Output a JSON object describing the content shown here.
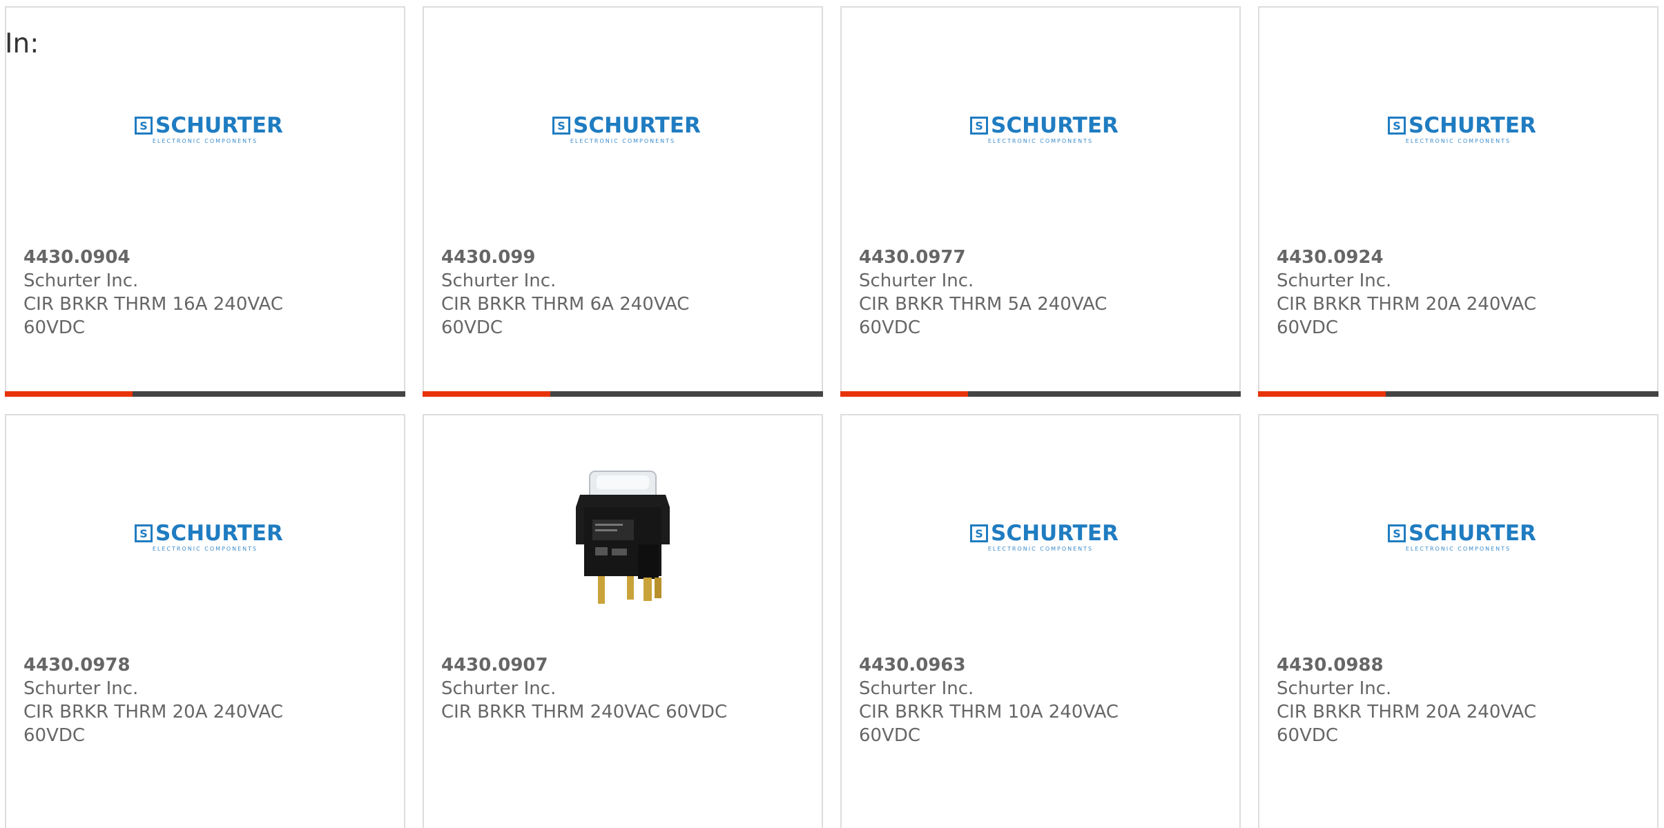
{
  "heading": "In:",
  "colors": {
    "accent": "#e8330a",
    "bar": "#444444",
    "brand": "#1f7cc1",
    "text": "#666666"
  },
  "brand_logo": {
    "word": "SCHURTER",
    "mark": "S",
    "tagline": "ELECTRONIC COMPONENTS"
  },
  "products": [
    {
      "part_number": "4430.0904",
      "manufacturer": "Schurter Inc.",
      "description": "CIR BRKR THRM 16A 240VAC 60VDC",
      "image": "schurter-logo"
    },
    {
      "part_number": "4430.099",
      "manufacturer": "Schurter Inc.",
      "description": "CIR BRKR THRM 6A 240VAC 60VDC",
      "image": "schurter-logo"
    },
    {
      "part_number": "4430.0977",
      "manufacturer": "Schurter Inc.",
      "description": "CIR BRKR THRM 5A 240VAC 60VDC",
      "image": "schurter-logo"
    },
    {
      "part_number": "4430.0924",
      "manufacturer": "Schurter Inc.",
      "description": "CIR BRKR THRM 20A 240VAC 60VDC",
      "image": "schurter-logo"
    },
    {
      "part_number": "4430.0978",
      "manufacturer": "Schurter Inc.",
      "description": "CIR BRKR THRM 20A 240VAC 60VDC",
      "image": "schurter-logo"
    },
    {
      "part_number": "4430.0907",
      "manufacturer": "Schurter Inc.",
      "description": "CIR BRKR THRM 240VAC 60VDC",
      "image": "circuit-breaker-photo"
    },
    {
      "part_number": "4430.0963",
      "manufacturer": "Schurter Inc.",
      "description": "CIR BRKR THRM 10A 240VAC 60VDC",
      "image": "schurter-logo"
    },
    {
      "part_number": "4430.0988",
      "manufacturer": "Schurter Inc.",
      "description": "CIR BRKR THRM 20A 240VAC 60VDC",
      "image": "schurter-logo"
    }
  ]
}
